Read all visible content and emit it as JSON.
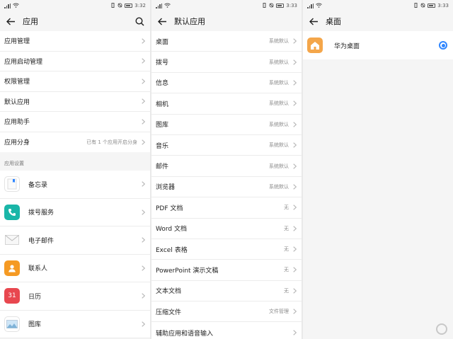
{
  "panel1": {
    "status": {
      "time": "3:32"
    },
    "title": "应用",
    "items": [
      {
        "label": "应用管理",
        "value": ""
      },
      {
        "label": "应用启动管理",
        "value": ""
      },
      {
        "label": "权限管理",
        "value": ""
      },
      {
        "label": "默认应用",
        "value": ""
      },
      {
        "label": "应用助手",
        "value": ""
      },
      {
        "label": "应用分身",
        "value": "已有 1 个应用开启分身"
      }
    ],
    "section_header": "应用设置",
    "apps": [
      {
        "label": "备忘录",
        "icon": "memo-icon",
        "color": "#ffffff"
      },
      {
        "label": "拨号服务",
        "icon": "phone-icon",
        "color": "#1ab6a8"
      },
      {
        "label": "电子邮件",
        "icon": "mail-icon",
        "color": "#ffffff"
      },
      {
        "label": "联系人",
        "icon": "contact-icon",
        "color": "#f59a23"
      },
      {
        "label": "日历",
        "icon": "calendar-icon",
        "color": "#e8474f",
        "icon_text": "31"
      },
      {
        "label": "图库",
        "icon": "gallery-icon",
        "color": "#ffffff"
      }
    ]
  },
  "panel2": {
    "status": {
      "time": "3:33"
    },
    "title": "默认应用",
    "items": [
      {
        "label": "桌面",
        "value": "系统默认"
      },
      {
        "label": "拨号",
        "value": "系统默认"
      },
      {
        "label": "信息",
        "value": "系统默认"
      },
      {
        "label": "相机",
        "value": "系统默认"
      },
      {
        "label": "图库",
        "value": "系统默认"
      },
      {
        "label": "音乐",
        "value": "系统默认"
      },
      {
        "label": "邮件",
        "value": "系统默认"
      },
      {
        "label": "浏览器",
        "value": "系统默认"
      },
      {
        "label": "PDF 文档",
        "value": "无"
      },
      {
        "label": "Word 文档",
        "value": "无"
      },
      {
        "label": "Excel 表格",
        "value": "无"
      },
      {
        "label": "PowerPoint 演示文稿",
        "value": "无"
      },
      {
        "label": "文本文档",
        "value": "无"
      },
      {
        "label": "压缩文件",
        "value": "文件管理"
      },
      {
        "label": "辅助应用和语音输入",
        "value": ""
      }
    ]
  },
  "panel3": {
    "status": {
      "time": "3:33"
    },
    "title": "桌面",
    "option": {
      "label": "华为桌面",
      "icon": "huawei-home-icon",
      "color": "#f4a64a",
      "selected": true
    }
  },
  "colors": {
    "accent": "#2f86ff"
  }
}
